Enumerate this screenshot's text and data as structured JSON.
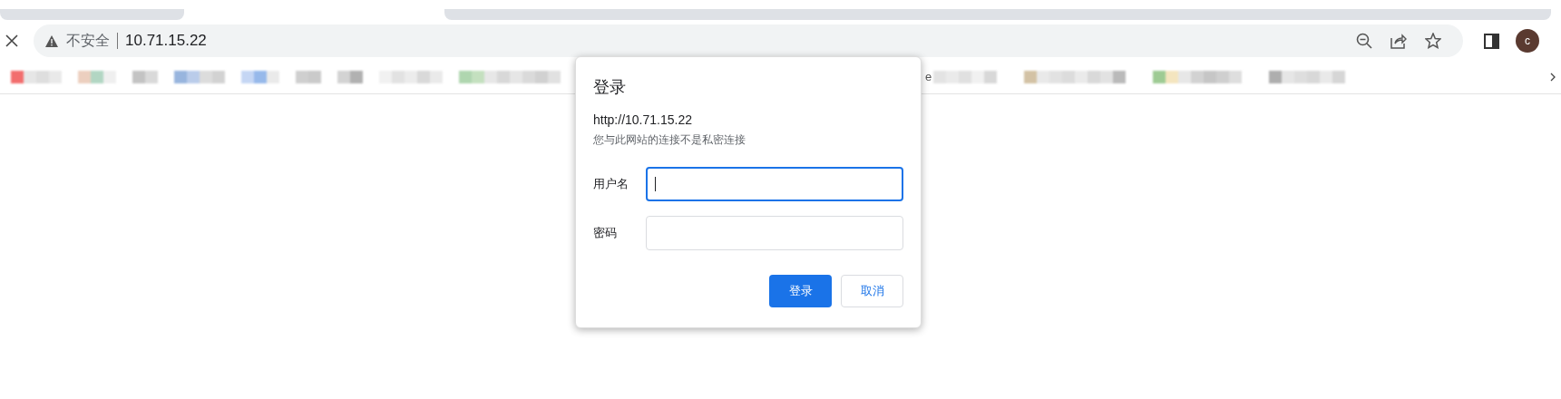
{
  "address_bar": {
    "security_label": "不安全",
    "url": "10.71.15.22"
  },
  "profile": {
    "initial": "c"
  },
  "bookmarks_fragment": "e",
  "dialog": {
    "title": "登录",
    "origin": "http://10.71.15.22",
    "notice": "您与此网站的连接不是私密连接",
    "fields": [
      {
        "label": "用户名",
        "focused": true
      },
      {
        "label": "密码",
        "focused": false
      }
    ],
    "buttons": [
      {
        "label": "登录",
        "kind": "primary"
      },
      {
        "label": "取消",
        "kind": "secondary"
      }
    ]
  }
}
